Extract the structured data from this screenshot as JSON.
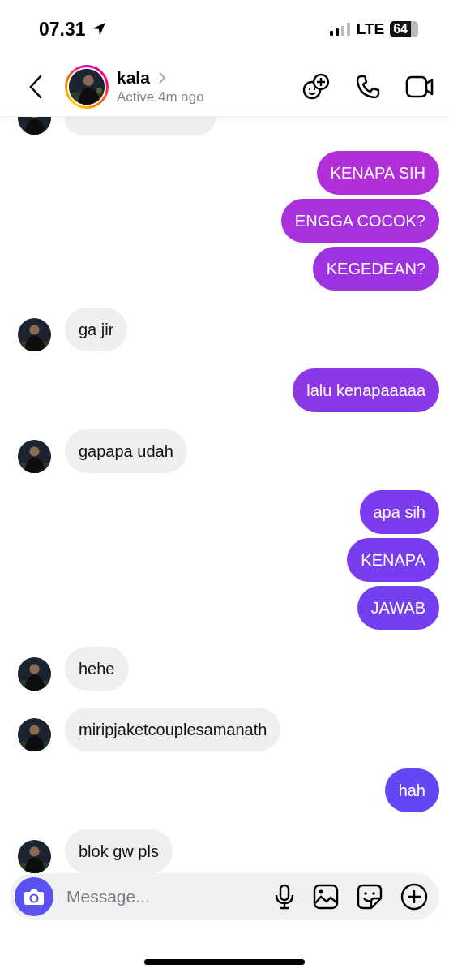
{
  "status_bar": {
    "time": "07.31",
    "network": "LTE",
    "battery": "64"
  },
  "header": {
    "name": "kala",
    "status": "Active 4m ago"
  },
  "messages": [
    {
      "kind": "partial"
    },
    {
      "kind": "outgoing",
      "text": "KENAPA SIH",
      "color": "#b02fd9"
    },
    {
      "kind": "outgoing",
      "text": "ENGGA COCOK?",
      "color": "#a731dc"
    },
    {
      "kind": "outgoing",
      "text": "KEGEDEAN?",
      "color": "#9d33e0"
    },
    {
      "kind": "incoming",
      "text": "ga jir"
    },
    {
      "kind": "outgoing",
      "text": "lalu kenapaaaaa",
      "color": "#8b37e6"
    },
    {
      "kind": "incoming",
      "text": "gapapa udah"
    },
    {
      "kind": "outgoing",
      "text": "apa sih",
      "color": "#7c3ced"
    },
    {
      "kind": "outgoing",
      "text": "KENAPA",
      "color": "#783eee"
    },
    {
      "kind": "outgoing",
      "text": "JAWAB",
      "color": "#7440ef"
    },
    {
      "kind": "incoming",
      "text": "hehe"
    },
    {
      "kind": "incoming",
      "text": "miripjaketcouplesamanath"
    },
    {
      "kind": "outgoing",
      "text": "hah",
      "color": "#6447f4"
    },
    {
      "kind": "incoming",
      "text": "blok gw pls"
    }
  ],
  "composer": {
    "placeholder": "Message..."
  }
}
